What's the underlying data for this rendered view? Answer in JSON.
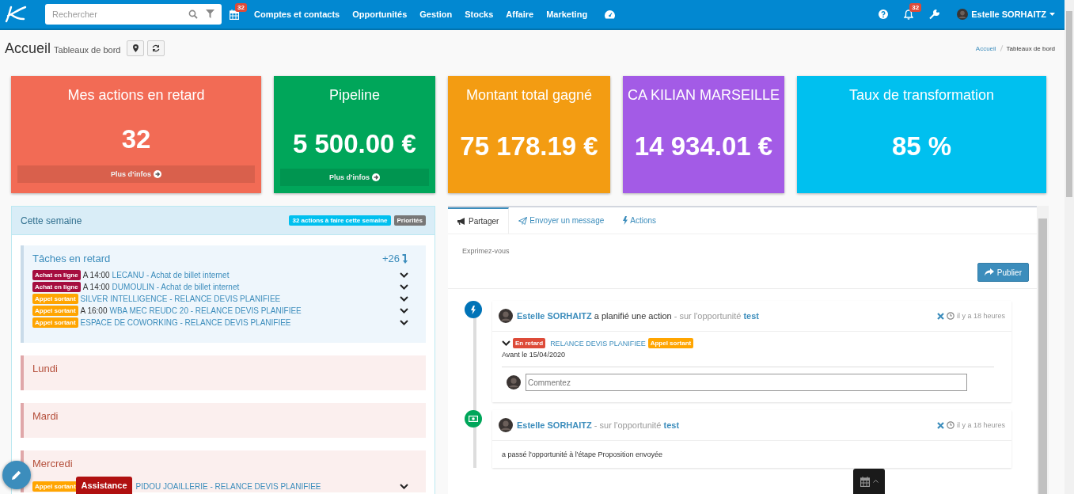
{
  "nav": {
    "search_placeholder": "Rechercher",
    "calendar_badge": "32",
    "menu": [
      "Comptes et contacts",
      "Opportunités",
      "Gestion",
      "Stocks",
      "Affaire",
      "Marketing"
    ],
    "notification_badge": "32",
    "user": "Estelle SORHAITZ"
  },
  "header": {
    "title": "Accueil",
    "subtitle": "Tableaux de bord",
    "breadcrumb": [
      "Accueil",
      "Tableaux de bord"
    ]
  },
  "tiles": [
    {
      "title": "Mes actions en retard",
      "value": "32",
      "more": "Plus d’infos",
      "color": "#f26b55"
    },
    {
      "title": "Pipeline",
      "value": "5 500.00 €",
      "more": "Plus d’infos",
      "color": "#00a65a"
    },
    {
      "title": "Montant total gagné",
      "value": "75 178.19 €",
      "color": "#f39c12"
    },
    {
      "title": "CA KILIAN MARSEILLE",
      "value": "14 934.01 €",
      "color": "#a35be6"
    },
    {
      "title": "Taux de transformation",
      "value": "85 %",
      "color": "#00c0ef"
    }
  ],
  "week": {
    "title": "Cette semaine",
    "badges": [
      {
        "label": "32 actions à faire cette semaine",
        "color": "#00c0ef"
      },
      {
        "label": "Priorités",
        "color": "#777777"
      }
    ],
    "sections": [
      {
        "kind": "late",
        "title": "Tâches en retard",
        "count": "+26",
        "tasks": [
          {
            "tag": {
              "label": "Achat en ligne",
              "color": "#a50d3f"
            },
            "time": "A 14:00",
            "text": "LECANU - Achat de billet internet"
          },
          {
            "tag": {
              "label": "Achat en ligne",
              "color": "#a50d3f"
            },
            "time": "A 14:00",
            "text": "DUMOULIN - Achat de billet internet"
          },
          {
            "tag": {
              "label": "Appel sortant",
              "color": "#ffa500"
            },
            "text": "SILVER INTELLIGENCE - RELANCE DEVIS PLANIFIEE"
          },
          {
            "tag": {
              "label": "Appel sortant",
              "color": "#ffa500"
            },
            "time": "A 16:00",
            "text": "WBA MEC REUDC 20 - RELANCE DEVIS PLANIFIEE"
          },
          {
            "tag": {
              "label": "Appel sortant",
              "color": "#ffa500"
            },
            "text": "ESPACE DE COWORKING - RELANCE DEVIS PLANIFIEE"
          }
        ]
      },
      {
        "kind": "day",
        "title": "Lundi"
      },
      {
        "kind": "day",
        "title": "Mardi"
      },
      {
        "kind": "day",
        "title": "Mercredi",
        "tasks": [
          {
            "tag": {
              "label": "Appel sortant",
              "color": "#ffa500"
            },
            "text": "PIDOU JOAILLERIE - RELANCE DEVIS PLANIFIEE"
          }
        ]
      }
    ]
  },
  "feed": {
    "tabs": [
      {
        "label": "Partager",
        "selected": true
      },
      {
        "label": "Envoyer un message",
        "selected": false
      },
      {
        "label": "Actions",
        "selected": false
      }
    ],
    "composer_placeholder": "Exprimez-vous",
    "publish": "Publier",
    "posts": [
      {
        "kind": "action",
        "color": "#0073b7",
        "author": "Estelle SORHAITZ",
        "action": "a planifié une action",
        "context": "- sur l'opportunité",
        "link": "test",
        "time": "il y a 18 heures",
        "status": {
          "label": "En retard",
          "color": "#dd4b39"
        },
        "task": "RELANCE DEVIS PLANIFIEE",
        "tag": {
          "label": "Appel sortant",
          "color": "#ffa500"
        },
        "due": "Avant le 15/04/2020",
        "comment_placeholder": "Commentez"
      },
      {
        "kind": "stage",
        "color": "#00a65a",
        "author": "Estelle SORHAITZ",
        "context": "- sur l'opportunité",
        "link": "test",
        "time": "il y a 18 heures",
        "text": "a passé l'opportunité à l'étape Proposition envoyée"
      }
    ]
  },
  "assistance": "Assistance"
}
